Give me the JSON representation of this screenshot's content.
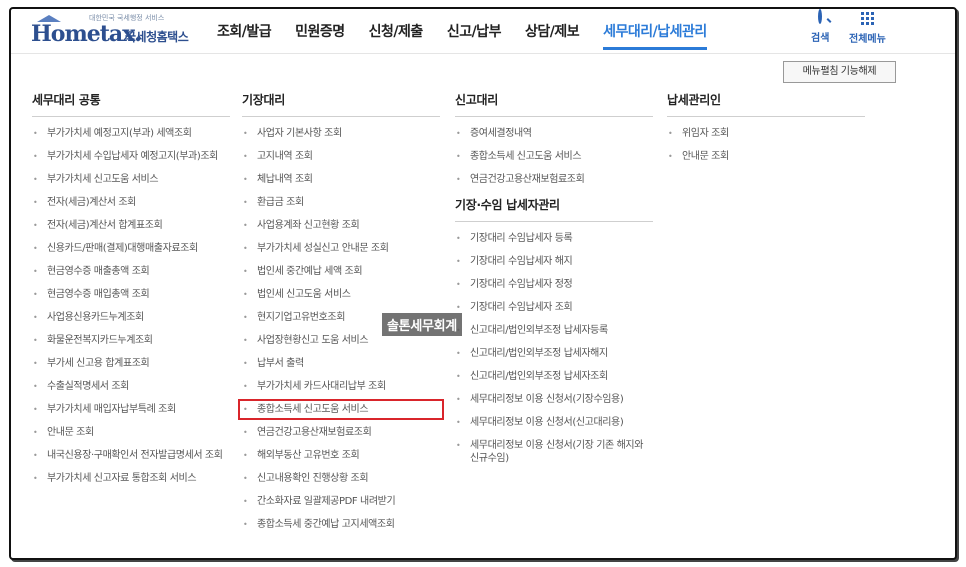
{
  "header": {
    "logo_tagline": "대한민국 국세행정 서비스",
    "logo_brand": "Hometax.",
    "logo_brand_kr": "국세청홈택스",
    "nav": [
      {
        "label": "조회/발급"
      },
      {
        "label": "민원증명"
      },
      {
        "label": "신청/제출"
      },
      {
        "label": "신고/납부"
      },
      {
        "label": "상담/제보"
      },
      {
        "label": "세무대리/납세관리"
      }
    ],
    "search_label": "검색",
    "all_menu_label": "전체메뉴"
  },
  "unfold_button_label": "메뉴펼침 기능해제",
  "columns": [
    {
      "title": "세무대리 공통",
      "items": [
        {
          "label": "부가가치세 예정고지(부과) 세액조회"
        },
        {
          "label": "부가가치세 수입납세자 예정고지(부과)조회"
        },
        {
          "label": "부가가치세 신고도움 서비스"
        },
        {
          "label": "전자(세금)계산서 조회"
        },
        {
          "label": "전자(세금)계산서 합계표조회"
        },
        {
          "label": "신용카드/판매(결제)대행매출자료조회"
        },
        {
          "label": "현금영수증 매출총액 조회"
        },
        {
          "label": "현금영수증 매입총액 조회"
        },
        {
          "label": "사업용신용카드누계조회"
        },
        {
          "label": "화물운전복지카드누계조회"
        },
        {
          "label": "부가세 신고용 합계표조회"
        },
        {
          "label": "수출실적명세서 조회"
        },
        {
          "label": "부가가치세 매입자납부특례 조회"
        },
        {
          "label": "안내문 조회"
        },
        {
          "label": "내국신용장·구매확인서 전자발급명세서 조회"
        },
        {
          "label": "부가가치세 신고자료 통합조회 서비스"
        }
      ]
    },
    {
      "title": "기장대리",
      "items": [
        {
          "label": "사업자 기본사항 조회"
        },
        {
          "label": "고지내역 조회"
        },
        {
          "label": "체납내역 조회"
        },
        {
          "label": "환급금 조회"
        },
        {
          "label": "사업용계좌 신고현황 조회"
        },
        {
          "label": "부가가치세 성실신고 안내문 조회"
        },
        {
          "label": "법인세 중간예납 세액 조회"
        },
        {
          "label": "법인세 신고도움 서비스"
        },
        {
          "label": "현지기업고유번호조회"
        },
        {
          "label": "사업장현황신고 도움 서비스"
        },
        {
          "label": "납부서 출력"
        },
        {
          "label": "부가가치세 카드사대리납부 조회"
        },
        {
          "label": "종합소득세 신고도움 서비스"
        },
        {
          "label": "연금건강고용산재보험료조회"
        },
        {
          "label": "해외부동산 고유번호 조회"
        },
        {
          "label": "신고내용확인 진행상황 조회"
        },
        {
          "label": "간소화자료 일괄제공PDF 내려받기"
        },
        {
          "label": "종합소득세 중간예납 고지세액조회"
        }
      ]
    },
    {
      "title": "신고대리",
      "items": [
        {
          "label": "증여세결정내역"
        },
        {
          "label": "종합소득세 신고도움 서비스"
        },
        {
          "label": "연금건강고용산재보험료조회"
        }
      ],
      "sub_title": "기장·수임 납세자관리",
      "sub_items": [
        {
          "label": "기장대리 수임납세자 등록"
        },
        {
          "label": "기장대리 수임납세자 해지"
        },
        {
          "label": "기장대리 수임납세자 정정"
        },
        {
          "label": "기장대리 수임납세자 조회"
        },
        {
          "label": "신고대리/법인외부조정 납세자등록"
        },
        {
          "label": "신고대리/법인외부조정 납세자해지"
        },
        {
          "label": "신고대리/법인외부조정 납세자조회"
        },
        {
          "label": "세무대리정보 이용 신청서(기장수임용)"
        },
        {
          "label": "세무대리정보 이용 신청서(신고대리용)"
        },
        {
          "label": "세무대리정보 이용 신청서(기장 기존 해지와 신규수임)"
        }
      ]
    },
    {
      "title": "납세관리인",
      "items": [
        {
          "label": "위임자 조회"
        },
        {
          "label": "안내문 조회"
        }
      ]
    }
  ],
  "watermark": "솔톤세무회계",
  "accent_color": "#2b7bd8",
  "highlight_color": "#d9252b"
}
